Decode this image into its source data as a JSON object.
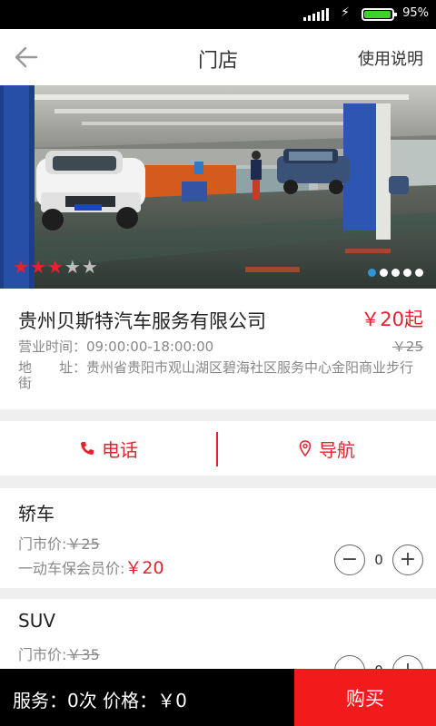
{
  "status_bar": {
    "battery": "95%",
    "battery_level": 0.95
  },
  "header": {
    "title": "门店",
    "help_label": "使用说明"
  },
  "store": {
    "rating": 3,
    "rating_max": 5,
    "carousel_count": 5,
    "carousel_active": 1,
    "name": "贵州贝斯特汽车服务有限公司",
    "price_from": "￥20起",
    "old_price": "￥25",
    "hours_label": "营业时间：",
    "hours_value": "09:00:00-18:00:00",
    "address_label": "地　　址：",
    "address_value": "贵州省贵阳市观山湖区碧海社区服务中心金阳商业步行街"
  },
  "actions": {
    "phone_label": "电话",
    "nav_label": "导航"
  },
  "services": [
    {
      "name": "轿车",
      "store_price_label": "门市价:",
      "store_price": "￥25",
      "member_price_label": "一动车保会员价:",
      "member_price": "￥20",
      "quantity": "0"
    },
    {
      "name": "SUV",
      "store_price_label": "门市价:",
      "store_price": "￥35",
      "quantity": "0"
    }
  ],
  "footer": {
    "summary": "服务：0次  价格：￥0",
    "buy_label": "购买"
  },
  "colors": {
    "accent": "#e8212f",
    "buy_button": "#f21a1a",
    "carousel_active": "#2b95d8"
  }
}
